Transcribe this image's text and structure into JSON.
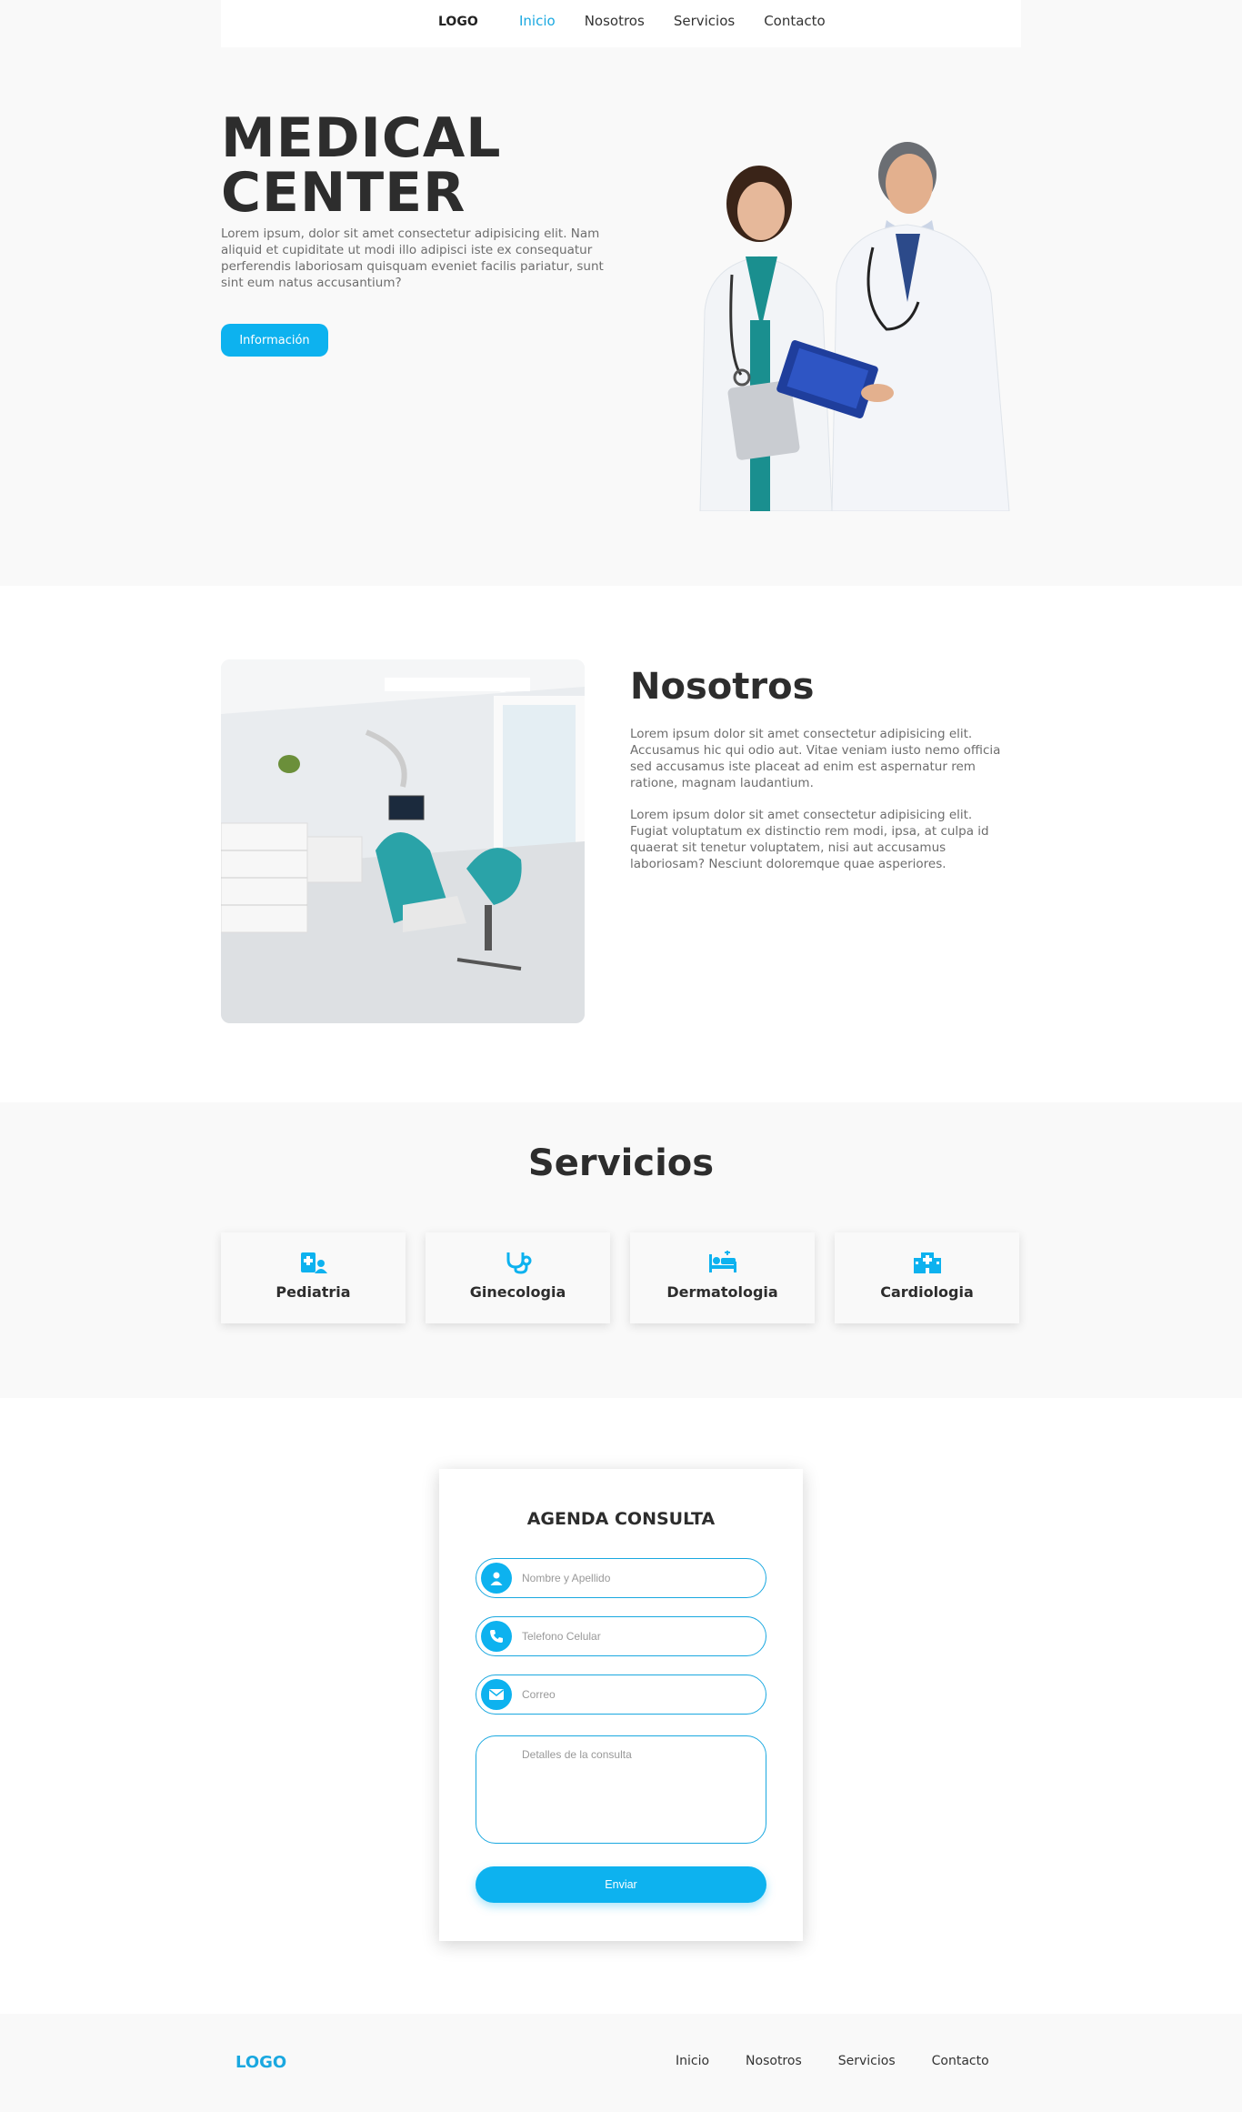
{
  "nav": {
    "logo": "LOGO",
    "links": [
      "Inicio",
      "Nosotros",
      "Servicios",
      "Contacto"
    ],
    "active": "Inicio"
  },
  "hero": {
    "title_line1": "MEDICAL",
    "title_line2": "CENTER",
    "text": "Lorem ipsum, dolor sit amet consectetur adipisicing elit. Nam aliquid et cupiditate ut modi illo adipisci iste ex consequatur perferendis laboriosam quisquam eveniet facilis pariatur, sunt sint eum natus accusantium?",
    "button": "Información"
  },
  "about": {
    "title": "Nosotros",
    "p1": "Lorem ipsum dolor sit amet consectetur adipisicing elit. Accusamus hic qui odio aut. Vitae veniam iusto nemo officia sed accusamus iste placeat ad enim est aspernatur rem ratione, magnam laudantium.",
    "p2": "Lorem ipsum dolor sit amet consectetur adipisicing elit. Fugiat voluptatum ex distinctio rem modi, ipsa, at culpa id quaerat sit tenetur voluptatem, nisi aut accusamus laboriosam? Nesciunt doloremque quae asperiores."
  },
  "services": {
    "title": "Servicios",
    "items": [
      {
        "label": "Pediatria",
        "icon": "pediatrics-icon"
      },
      {
        "label": "Ginecologia",
        "icon": "stethoscope-icon"
      },
      {
        "label": "Dermatologia",
        "icon": "hospital-bed-icon"
      },
      {
        "label": "Cardiologia",
        "icon": "hospital-building-icon"
      }
    ]
  },
  "form": {
    "title": "AGENDA CONSULTA",
    "name_placeholder": "Nombre y Apellido",
    "phone_placeholder": "Telefono Celular",
    "email_placeholder": "Correo",
    "details_placeholder": "Detalles de la consulta",
    "submit": "Enviar"
  },
  "footer": {
    "logo": "LOGO",
    "links": [
      "Inicio",
      "Nosotros",
      "Servicios",
      "Contacto"
    ]
  },
  "colors": {
    "accent": "#0db2ef",
    "heading": "#2d2d2d",
    "text": "#6d6d6d"
  }
}
